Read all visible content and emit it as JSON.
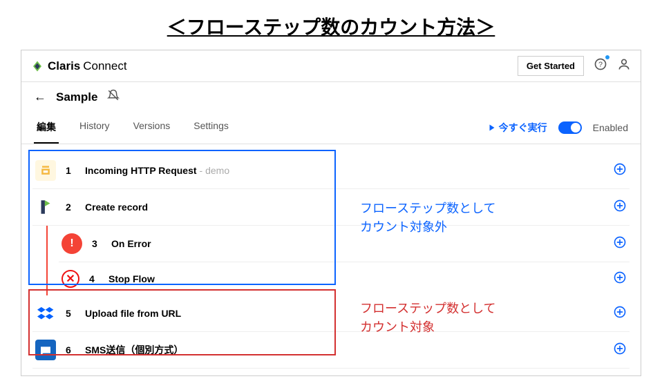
{
  "page_title": "＜フローステップ数のカウント方法＞",
  "brand": {
    "name": "Claris",
    "sub": "Connect"
  },
  "top_actions": {
    "get_started": "Get Started"
  },
  "flow": {
    "name": "Sample"
  },
  "tabs": {
    "edit": "編集",
    "history": "History",
    "versions": "Versions",
    "settings": "Settings"
  },
  "run": {
    "label": "今すぐ実行",
    "enabled_label": "Enabled"
  },
  "steps": [
    {
      "num": "1",
      "title": "Incoming HTTP Request",
      "meta": "- demo"
    },
    {
      "num": "2",
      "title": "Create record"
    },
    {
      "num": "3",
      "title": "On Error"
    },
    {
      "num": "4",
      "title": "Stop Flow"
    },
    {
      "num": "5",
      "title": "Upload file from URL"
    },
    {
      "num": "6",
      "title": "SMS送信（個別方式）"
    }
  ],
  "annotations": {
    "blue_line1": "フローステップ数として",
    "blue_line2": "カウント対象外",
    "red_line1": "フローステップ数として",
    "red_line2": "カウント対象"
  }
}
